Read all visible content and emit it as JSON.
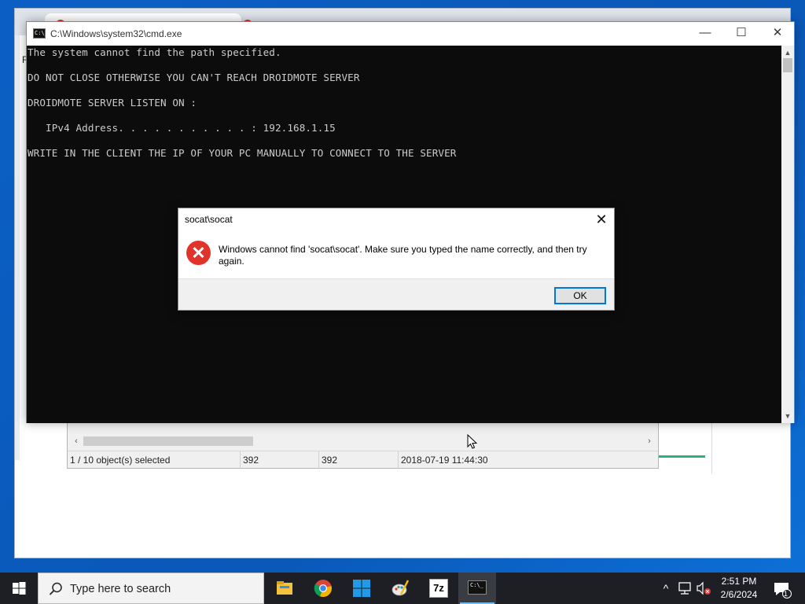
{
  "cmd_window": {
    "title": "C:\\Windows\\system32\\cmd.exe",
    "buttons": {
      "minimize": "—",
      "maximize": "☐",
      "close": "✕"
    },
    "console_lines": [
      "The system cannot find the path specified.",
      "DO NOT CLOSE OTHERWISE YOU CAN'T REACH DROIDMOTE SERVER",
      "DROIDMOTE SERVER LISTEN ON :",
      "   IPv4 Address. . . . . . . . . . . : 192.168.1.15",
      "WRITE IN THE CLIENT THE IP OF YOUR PC MANUALLY TO CONNECT TO THE SERVER"
    ]
  },
  "dialog": {
    "title": "socat\\socat",
    "close": "✕",
    "icon": "error-icon",
    "message": "Windows cannot find 'socat\\socat'. Make sure you typed the name correctly, and then try again.",
    "ok_label": "OK"
  },
  "file_manager": {
    "status": {
      "selection": "1 / 10 object(s) selected",
      "size": "392",
      "packed_size": "392",
      "modified": "2018-07-19 11:44:30"
    },
    "scroll_left": "‹",
    "scroll_right": "›"
  },
  "background_browser": {
    "edge_letter": "R"
  },
  "taskbar": {
    "search_placeholder": "Type here to search",
    "apps": [
      "file-explorer-icon",
      "chrome-icon",
      "start-menu-app-icon",
      "paint-icon",
      "7zip-icon",
      "cmd-icon"
    ],
    "app_7zip_label": "7z",
    "clock_time": "2:51 PM",
    "clock_date": "2/6/2024",
    "notification_count": "1",
    "tray_chevron": "^"
  },
  "colors": {
    "console_bg": "#0c0c0c",
    "console_text": "#cccccc",
    "accent": "#0078d7",
    "error_red": "#e0342a",
    "taskbar": "#1d1f25"
  }
}
